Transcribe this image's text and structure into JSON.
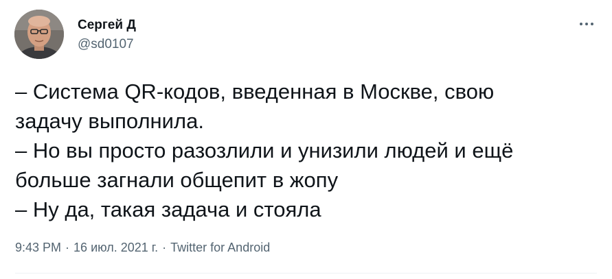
{
  "author": {
    "display_name": "Сергей Д",
    "handle": "@sd0107"
  },
  "more_icon": "more-horizontal-icon",
  "tweet": {
    "lines": [
      "– Система QR-кодов, введенная в Москве, свою",
      "задачу выполнила.",
      "– Но вы просто разозлили и унизили людей и ещё",
      "больше загнали общепит в жопу",
      "– Ну да, такая задача и стояла"
    ]
  },
  "meta": {
    "time": "9:43 PM",
    "separator": "·",
    "date": "16 июл. 2021 г.",
    "source": "Twitter for Android"
  },
  "colors": {
    "text": "#0f1419",
    "secondary": "#536471",
    "divider": "#eff3f4"
  }
}
